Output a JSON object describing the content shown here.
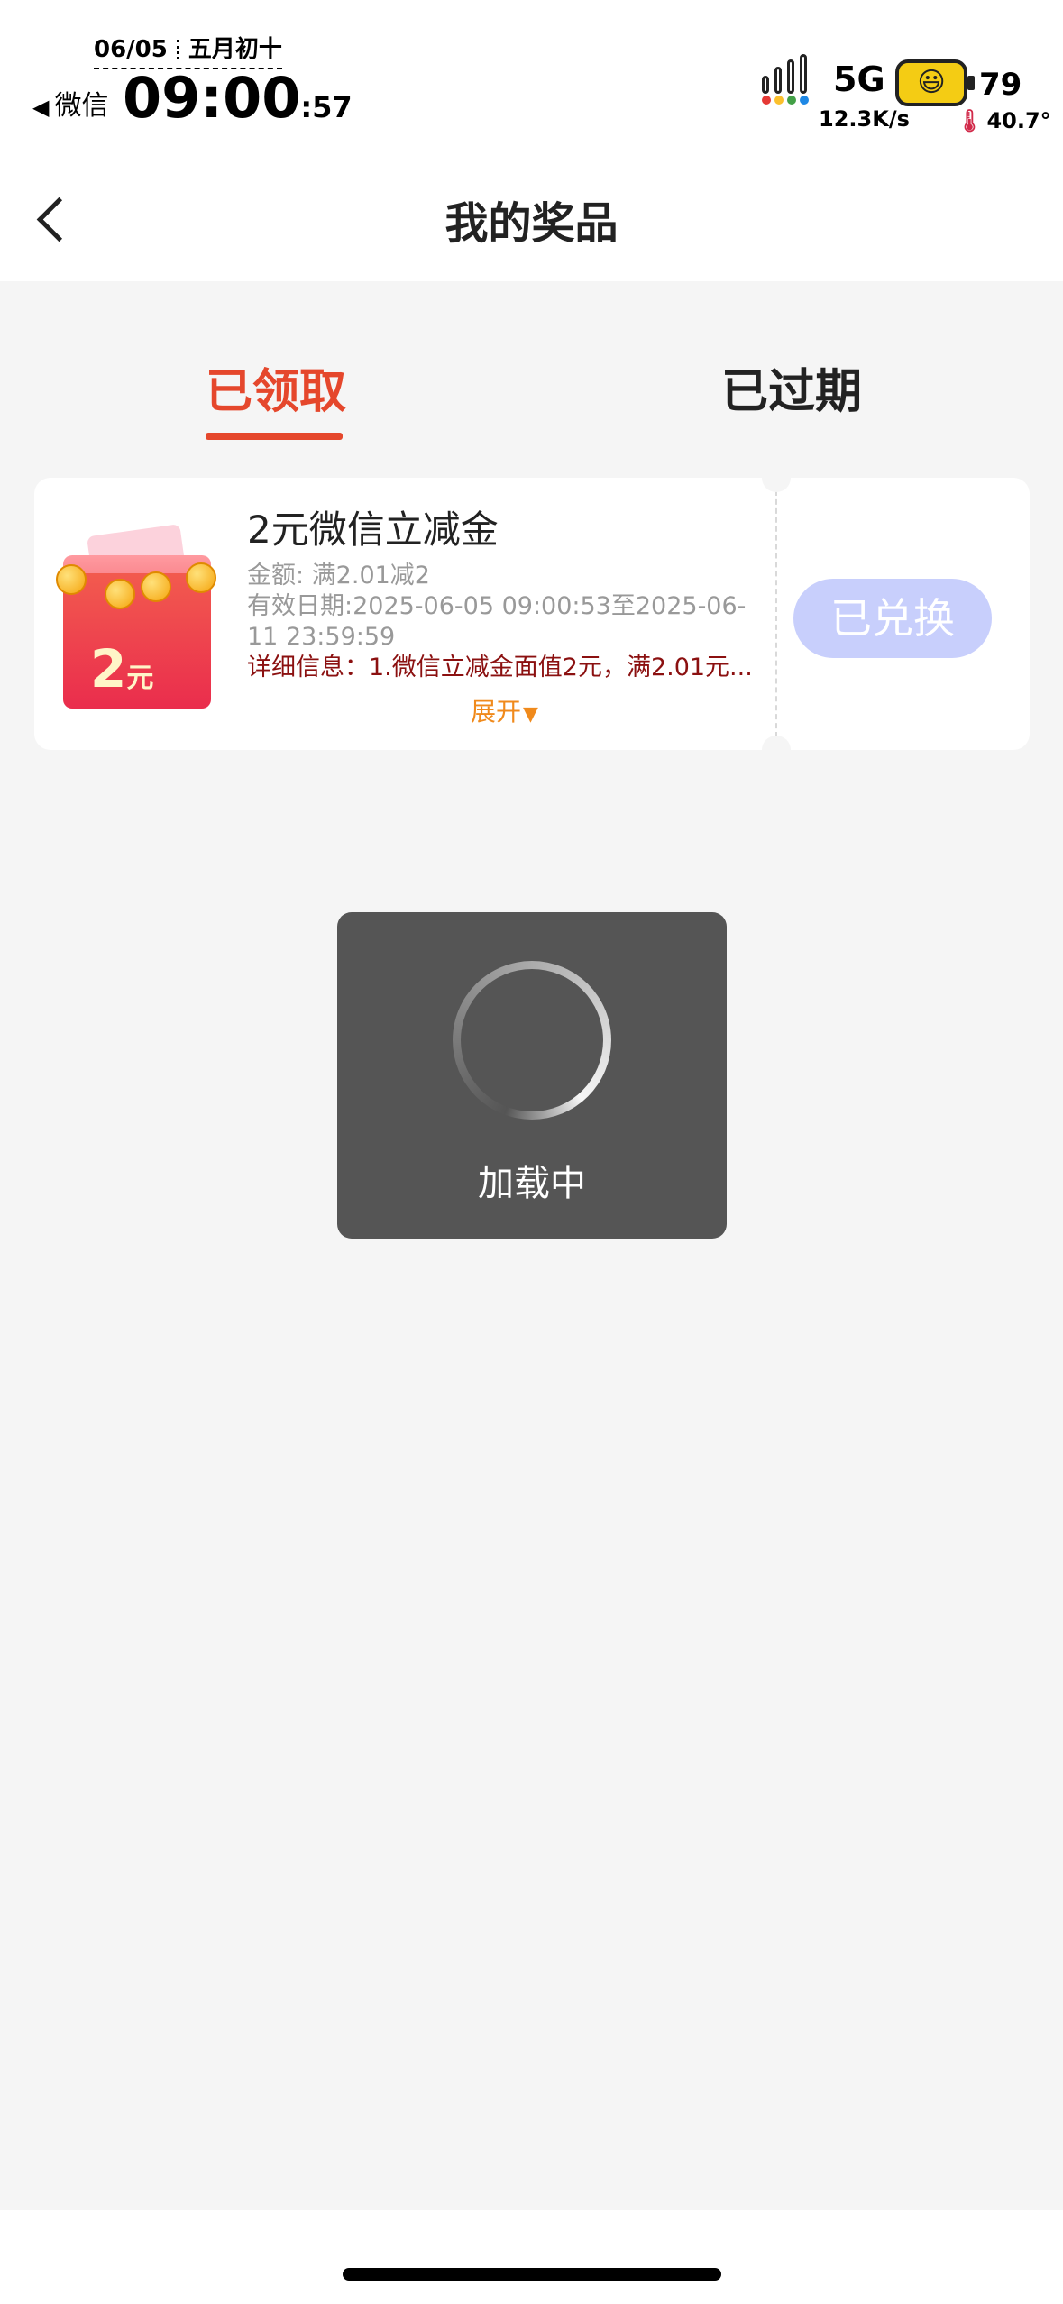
{
  "status_bar": {
    "date": "06/05",
    "lunar_date": "五月初十",
    "back_app": "微信",
    "time": "09:00",
    "seconds": ":57",
    "network_type": "5G",
    "network_speed": "12.3K/s",
    "battery_level": "79",
    "battery_face": "😃",
    "temperature": "40.7°",
    "signal_colors": [
      "#e53935",
      "#fbc02d",
      "#43a047",
      "#1e88e5"
    ]
  },
  "nav": {
    "title": "我的奖品"
  },
  "tabs": [
    {
      "label": "已领取",
      "active": true
    },
    {
      "label": "已过期",
      "active": false
    }
  ],
  "coupon": {
    "image_amount": "2",
    "image_unit": "元",
    "title": "2元微信立减金",
    "amount_info": "金额: 满2.01减2",
    "validity": "有效日期:2025-06-05 09:00:53至2025-06-11 23:59:59",
    "detail": "详细信息：1.微信立减金面值2元，满2.01元...",
    "expand_label": "展开",
    "expand_arrow": "▼",
    "status_label": "已兑换"
  },
  "loading": {
    "label": "加载中"
  },
  "colors": {
    "accent": "#e5472c",
    "redeemed_button": "#c8cffc",
    "expand_link": "#f08a1c",
    "detail_text": "#8b1010"
  }
}
